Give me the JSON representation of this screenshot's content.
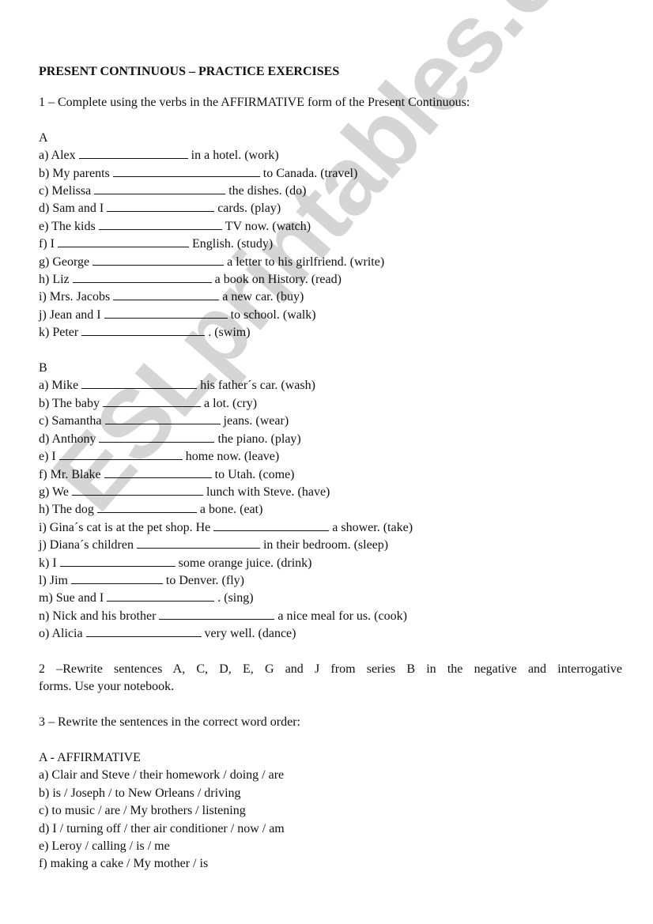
{
  "watermark": "ESLprintables.com",
  "title": "PRESENT CONTINUOUS – PRACTICE EXERCISES",
  "exercise1": {
    "instruction": "1 – Complete using the verbs in the AFFIRMATIVE form of the Present Continuous:",
    "seriesA": {
      "label": "A",
      "items": [
        {
          "prefix": "a) Alex",
          "suffix": "in a hotel. (work)",
          "blank": 138
        },
        {
          "prefix": "b) My parents",
          "suffix": "to Canada. (travel)",
          "blank": 186
        },
        {
          "prefix": "c) Melissa",
          "suffix": "the dishes. (do)",
          "blank": 166
        },
        {
          "prefix": "d) Sam and I",
          "suffix": "cards. (play)",
          "blank": 136
        },
        {
          "prefix": "e) The kids",
          "suffix": "TV now. (watch)",
          "blank": 156
        },
        {
          "prefix": "f) I",
          "suffix": "English. (study)",
          "blank": 166
        },
        {
          "prefix": "g) George",
          "suffix": "a letter to his girlfriend. (write)",
          "blank": 166
        },
        {
          "prefix": "h) Liz",
          "suffix": "a book on History. (read)",
          "blank": 176
        },
        {
          "prefix": "i) Mrs. Jacobs",
          "suffix": "a new car. (buy)",
          "blank": 134
        },
        {
          "prefix": "j) Jean and I",
          "suffix": "to school. (walk)",
          "blank": 156
        },
        {
          "prefix": "k) Peter",
          "suffix": ". (swim)",
          "blank": 156
        }
      ]
    },
    "seriesB": {
      "label": "B",
      "items": [
        {
          "prefix": "a) Mike",
          "suffix": "his father´s car. (wash)",
          "blank": 146
        },
        {
          "prefix": "b) The baby",
          "suffix": "a lot. (cry)",
          "blank": 124
        },
        {
          "prefix": "c) Samantha",
          "suffix": "jeans. (wear)",
          "blank": 146
        },
        {
          "prefix": "d) Anthony",
          "suffix": "the piano. (play)",
          "blank": 146
        },
        {
          "prefix": "e) I",
          "suffix": "home now. (leave)",
          "blank": 156
        },
        {
          "prefix": "f) Mr. Blake",
          "suffix": "to Utah. (come)",
          "blank": 136
        },
        {
          "prefix": "g) We",
          "suffix": "lunch with Steve. (have)",
          "blank": 166
        },
        {
          "prefix": "h) The dog",
          "suffix": "a bone. (eat)",
          "blank": 126
        },
        {
          "prefix": "i) Gina´s cat is at the pet shop. He",
          "suffix": "a shower. (take)",
          "blank": 146
        },
        {
          "prefix": "j) Diana´s children",
          "suffix": "in their bedroom. (sleep)",
          "blank": 156
        },
        {
          "prefix": "k) I",
          "suffix": "some orange juice. (drink)",
          "blank": 146
        },
        {
          "prefix": "l) Jim",
          "suffix": "to Denver. (fly)",
          "blank": 116
        },
        {
          "prefix": "m) Sue and I",
          "suffix": ". (sing)",
          "blank": 136
        },
        {
          "prefix": "n) Nick and his brother",
          "suffix": "a nice meal for us. (cook)",
          "blank": 146
        },
        {
          "prefix": "o) Alicia",
          "suffix": "very well.  (dance)",
          "blank": 146
        }
      ]
    }
  },
  "exercise2": {
    "line1": "2 –Rewrite sentences A, C, D, E, G and J from series B in the negative and interrogative",
    "line2": "forms. Use your notebook."
  },
  "exercise3": {
    "instruction": "3 – Rewrite the sentences in the correct word order:",
    "sectionA": {
      "label": "A - AFFIRMATIVE",
      "items": [
        "a) Clair and Steve / their homework / doing / are",
        "b) is / Joseph / to New Orleans / driving",
        "c) to music / are / My brothers / listening",
        "d) I / turning off / ther air conditioner / now / am",
        "e) Leroy / calling / is / me",
        "f) making a cake / My mother / is"
      ]
    }
  }
}
